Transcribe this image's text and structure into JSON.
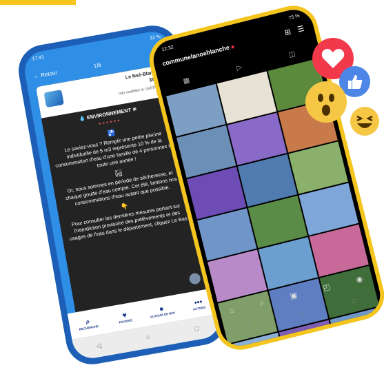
{
  "left_phone": {
    "status_time": "17:41",
    "status_right": "32 %",
    "header": {
      "back_label": "Retour",
      "page_indicator": "1/6"
    },
    "post": {
      "commune": "Le Nsé-Blanche",
      "zip": "35470",
      "date": "Info modifiée le 15/07/2022",
      "heading": "ENVIRONNEMENT",
      "stars": "★★★★★★",
      "paragraphs": [
        "Le saviez-vous ? Remplir une petite piscine individuelle de 5 m3 représente 10 % de la consommation d'eau d'une famille de 4 personnes sur toute une année !",
        "Or, nous sommes en période de sécheresse, et chaque goutte d'eau compte. Cet été, limitons nos consommations d'eau autant que possible.",
        "Pour consulter les dernières mesures portant sur l'interdiction provisoire des prélèvements et des usages de l'eau dans le département, cliquez Le Bas"
      ]
    },
    "nav": [
      {
        "label": "RECHERCHE",
        "icon": "search-icon"
      },
      {
        "label": "FAVORIS",
        "icon": "heart-icon"
      },
      {
        "label": "AUTOUR DE MOI",
        "icon": "map-pin-icon"
      },
      {
        "label": "AUTRES",
        "icon": "more-icon"
      }
    ]
  },
  "right_phone": {
    "status_time": "12:32",
    "status_right": "75 %",
    "profile_name": "communelanoeblanche",
    "colors": {
      "tiles": [
        "#7e9fc4",
        "#e6e3d6",
        "#5b8a3d",
        "#6c8fb8",
        "#8a6ac9",
        "#c97a4a",
        "#6d4db5",
        "#4f7bb0",
        "#8ab06b",
        "#6f95c9",
        "#5a8c48",
        "#7fa6d8",
        "#b98ac8",
        "#6d9ed0",
        "#c76a9a",
        "#7f9e6a",
        "#5f7ec1",
        "#3f6e3a",
        "#8ab0d8",
        "#7d5fb8",
        "#6f98c9"
      ]
    }
  },
  "reactions": [
    "heart-icon",
    "like-icon",
    "wow-icon",
    "haha-icon"
  ]
}
